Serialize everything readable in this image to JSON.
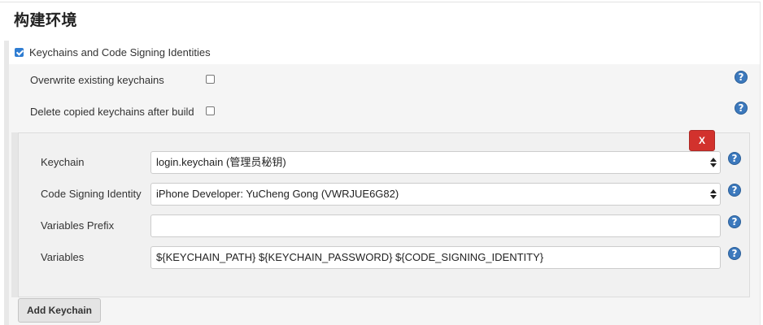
{
  "section": {
    "title": "构建环境"
  },
  "keychains_option": {
    "label": "Keychains and Code Signing Identities",
    "checked": true
  },
  "options": [
    {
      "label": "Overwrite existing keychains",
      "checked": false
    },
    {
      "label": "Delete copied keychains after build",
      "checked": false
    }
  ],
  "keychain_entry": {
    "delete_label": "X",
    "keychain": {
      "label": "Keychain",
      "value": "login.keychain (管理员秘钥)"
    },
    "identity": {
      "label": "Code Signing Identity",
      "value": "iPhone Developer: YuCheng Gong (VWRJUE6G82)"
    },
    "prefix": {
      "label": "Variables Prefix",
      "value": ""
    },
    "variables": {
      "label": "Variables",
      "value": "${KEYCHAIN_PATH} ${KEYCHAIN_PASSWORD} ${CODE_SIGNING_IDENTITY}"
    }
  },
  "add_button": {
    "label": "Add Keychain"
  },
  "help_icon_text": "?",
  "colors": {
    "accent": "#3c79bd",
    "danger": "#d2322d",
    "checkbox": "#2f7dd2"
  }
}
